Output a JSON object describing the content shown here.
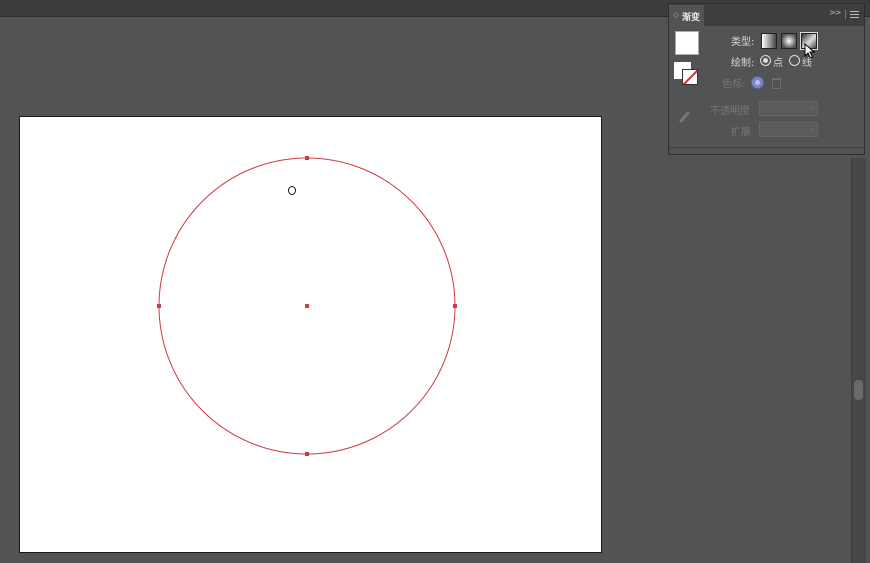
{
  "gradient_panel": {
    "tab_label": "渐变",
    "type_label": "类型:",
    "draw_label": "绘制:",
    "point_label": "点",
    "line_label": "线",
    "color_stop_label": "色标:",
    "opacity_label": "不透明度",
    "spread_label": "扩展",
    "collapse_icon": "double-chevron-right-icon",
    "menu_icon": "hamburger-menu-icon",
    "selected_type": "freeform",
    "selected_draw": "point"
  },
  "canvas": {
    "shape": "circle",
    "shape_stroke_color": "#d0393f",
    "artboard_color": "#ffffff",
    "background_color": "#535353"
  },
  "colors": {
    "panel_bg": "#535353",
    "panel_header": "#3e3e3e",
    "accent_stop": "#7a86c8"
  }
}
